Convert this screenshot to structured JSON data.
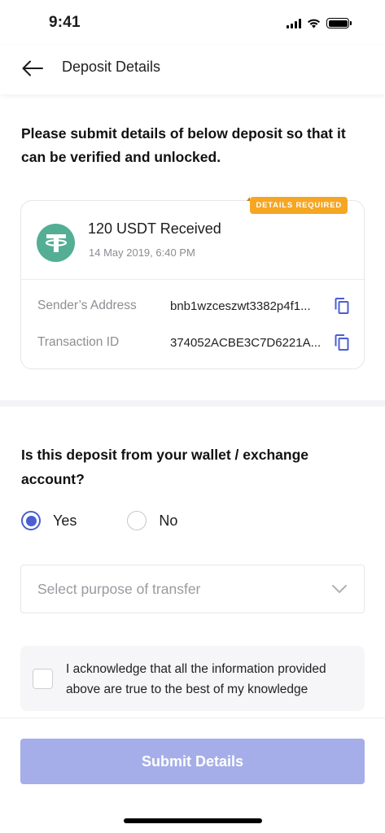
{
  "status_bar": {
    "time": "9:41",
    "icons": [
      "signal-icon",
      "wifi-icon",
      "battery-icon"
    ]
  },
  "header": {
    "title": "Deposit Details",
    "back_icon": "arrow-left-icon"
  },
  "intro_text": "Please submit details of below deposit so that  it can be verified and unlocked.",
  "deposit_card": {
    "badge": "DETAILS REQUIRED",
    "badge_color": "#f5a623",
    "coin_icon": "tether-icon",
    "coin_color": "#53ae94",
    "amount": "120 USDT Received",
    "date": "14 May 2019, 6:40 PM",
    "rows": [
      {
        "label": "Sender’s Address",
        "value": "bnb1wzceszwt3382p4f1...",
        "action_icon": "copy-icon"
      },
      {
        "label": "Transaction ID",
        "value": "374052ACBE3C7D6221A...",
        "action_icon": "copy-icon"
      }
    ]
  },
  "question": {
    "text": "Is this deposit from your wallet / exchange account?",
    "options": [
      {
        "label": "Yes",
        "selected": true
      },
      {
        "label": "No",
        "selected": false
      }
    ]
  },
  "purpose_select": {
    "placeholder": "Select purpose of transfer",
    "icon": "chevron-down-icon"
  },
  "acknowledgement": {
    "text": "I acknowledge that all the information provided above are true to the best of my knowledge",
    "checked": false
  },
  "submit_button": {
    "label": "Submit Details",
    "color": "#a5aee8"
  },
  "accent_color": "#4a5fd1"
}
